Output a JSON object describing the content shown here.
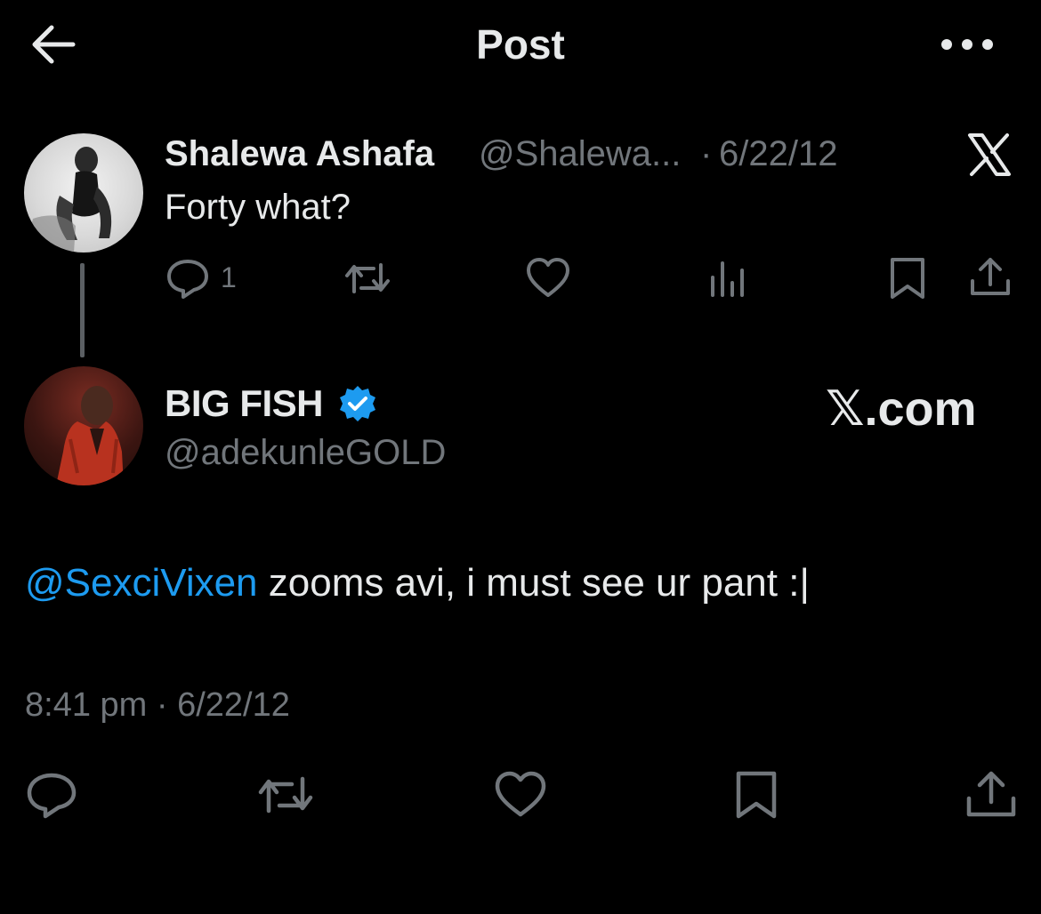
{
  "header": {
    "title": "Post",
    "back_icon": "arrow-left-icon",
    "more_icon": "more-horizontal-icon"
  },
  "parent_tweet": {
    "author_name": "Shalewa Ashafa",
    "author_handle": "@Shalewa...",
    "separator": "·",
    "date": "6/22/12",
    "text": "Forty what?",
    "reply_count": "1",
    "icons": [
      "reply-icon",
      "retweet-icon",
      "like-icon",
      "views-icon",
      "bookmark-icon",
      "share-icon"
    ]
  },
  "main_tweet": {
    "author_name": "BIG FISH",
    "author_handle": "@adekunleGOLD",
    "verified": true,
    "mention": "@SexciVixen",
    "text": " zooms avi, i must see ur pant :|",
    "time": "8:41 pm · 6/22/12",
    "icons": [
      "reply-icon",
      "retweet-icon",
      "like-icon",
      "bookmark-icon",
      "share-icon"
    ]
  },
  "watermark": {
    "xcom_text": "𝕏.com"
  },
  "colors": {
    "background": "#000000",
    "text_primary": "#e7e9ea",
    "text_secondary": "#71767b",
    "link": "#1d9bf0",
    "verified": "#1d9bf0"
  }
}
